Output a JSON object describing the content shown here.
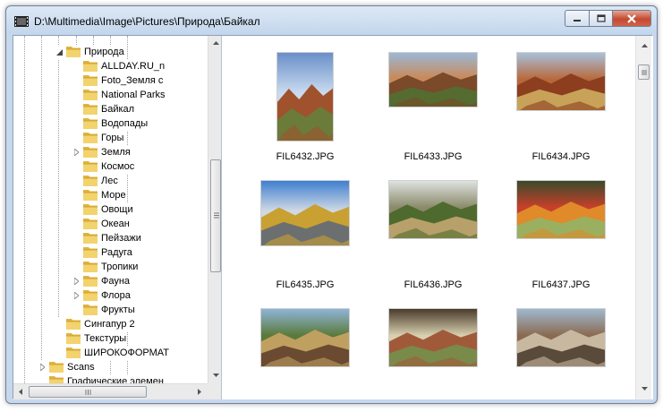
{
  "window": {
    "title": "D:\\Multimedia\\Image\\Pictures\\Природа\\Байкал"
  },
  "tree": {
    "items": [
      {
        "label": "Природа",
        "level": 4,
        "expander": "expanded"
      },
      {
        "label": "ALLDAY.RU_n",
        "level": 5,
        "expander": "none"
      },
      {
        "label": "Foto_Земля с",
        "level": 5,
        "expander": "none"
      },
      {
        "label": "National Parks",
        "level": 5,
        "expander": "none"
      },
      {
        "label": "Байкал",
        "level": 5,
        "expander": "none"
      },
      {
        "label": "Водопады",
        "level": 5,
        "expander": "none"
      },
      {
        "label": "Горы",
        "level": 5,
        "expander": "none"
      },
      {
        "label": "Земля",
        "level": 5,
        "expander": "collapsed"
      },
      {
        "label": "Космос",
        "level": 5,
        "expander": "none"
      },
      {
        "label": "Лес",
        "level": 5,
        "expander": "none"
      },
      {
        "label": "Море",
        "level": 5,
        "expander": "none"
      },
      {
        "label": "Овощи",
        "level": 5,
        "expander": "none"
      },
      {
        "label": "Океан",
        "level": 5,
        "expander": "none"
      },
      {
        "label": "Пейзажи",
        "level": 5,
        "expander": "none"
      },
      {
        "label": "Радуга",
        "level": 5,
        "expander": "none"
      },
      {
        "label": "Тропики",
        "level": 5,
        "expander": "none"
      },
      {
        "label": "Фауна",
        "level": 5,
        "expander": "collapsed"
      },
      {
        "label": "Флора",
        "level": 5,
        "expander": "collapsed"
      },
      {
        "label": "Фрукты",
        "level": 5,
        "expander": "none"
      },
      {
        "label": "Сингапур 2",
        "level": 4,
        "expander": "none"
      },
      {
        "label": "Текстуры",
        "level": 4,
        "expander": "none"
      },
      {
        "label": "ШИРОКОФОРМАТ",
        "level": 4,
        "expander": "none"
      },
      {
        "label": "Scans",
        "level": 3,
        "expander": "collapsed"
      },
      {
        "label": "Графические элемен",
        "level": 3,
        "expander": "none"
      }
    ],
    "vscroll_position": 0.6,
    "hscroll_position": 0.0
  },
  "thumbnails": {
    "items": [
      {
        "name": "FIL6432.JPG",
        "icon": "photo-baikal-shore-portrait",
        "colors": [
          "#6a8fc8",
          "#c9dbf0",
          "#a0522d",
          "#6b7b3a"
        ]
      },
      {
        "name": "FIL6433.JPG",
        "icon": "photo-rocky-hillside",
        "colors": [
          "#9ab8d8",
          "#c98a5a",
          "#7a4a2a",
          "#556b2f"
        ]
      },
      {
        "name": "FIL6434.JPG",
        "icon": "photo-autumn-cliffs",
        "colors": [
          "#a8c0dc",
          "#b8683a",
          "#8c3e1e",
          "#c9a25a"
        ]
      },
      {
        "name": "FIL6435.JPG",
        "icon": "photo-larch-tree-lakeside",
        "colors": [
          "#3f7fd0",
          "#cfd9e4",
          "#c9a032",
          "#6b6f6f"
        ]
      },
      {
        "name": "FIL6436.JPG",
        "icon": "photo-misty-forest",
        "colors": [
          "#dde2e0",
          "#8a8a6a",
          "#4e6a2e",
          "#b8a06a"
        ]
      },
      {
        "name": "FIL6437.JPG",
        "icon": "photo-red-leaves-macro",
        "colors": [
          "#3a4a2a",
          "#c8402a",
          "#e08a2a",
          "#9ab060"
        ]
      },
      {
        "name": "",
        "icon": "photo-mountain-valley",
        "colors": [
          "#8fb4d8",
          "#5a7a3a",
          "#c0a060",
          "#6a4a30"
        ]
      },
      {
        "name": "",
        "icon": "photo-lichen-macro",
        "colors": [
          "#4a3a2a",
          "#d8d0b0",
          "#a05a3a",
          "#7a8a4a"
        ]
      },
      {
        "name": "",
        "icon": "photo-forest-rocks",
        "colors": [
          "#a0b8d0",
          "#8a6a50",
          "#c8b8a0",
          "#5a4a3a"
        ]
      }
    ]
  }
}
